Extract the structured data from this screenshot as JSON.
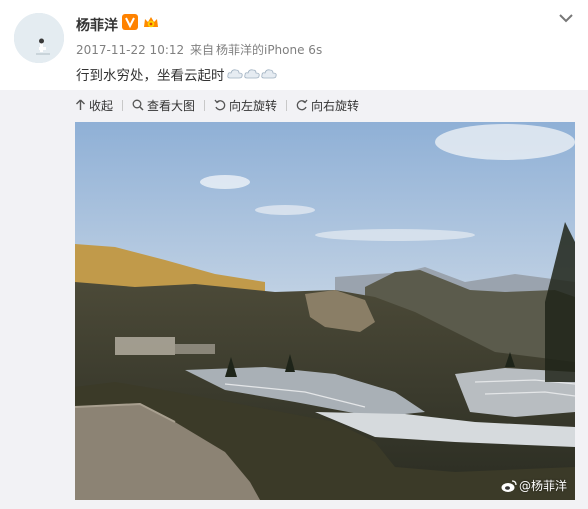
{
  "post": {
    "username": "杨菲洋",
    "timestamp": "2017-11-22 10:12",
    "source_prefix": "来自",
    "source_device": "杨菲洋的iPhone 6s",
    "content_text": "行到水穷处，坐看云起时",
    "content_emoji": [
      "cloud-emoji",
      "cloud-emoji",
      "cloud-emoji"
    ],
    "badges": [
      "verified-v-icon",
      "vip-crown-icon"
    ]
  },
  "toolbar": {
    "collapse_label": "收起",
    "view_large_label": "查看大图",
    "rotate_left_label": "向左旋转",
    "rotate_right_label": "向右旋转"
  },
  "photo": {
    "alt": "landscape-photo-terraced-fields",
    "watermark": "@杨菲洋"
  },
  "colors": {
    "accent_orange": "#f5a623",
    "badge_orange": "#ff8200",
    "meta_gray": "#808080",
    "panel_bg": "#f2f2f5"
  }
}
